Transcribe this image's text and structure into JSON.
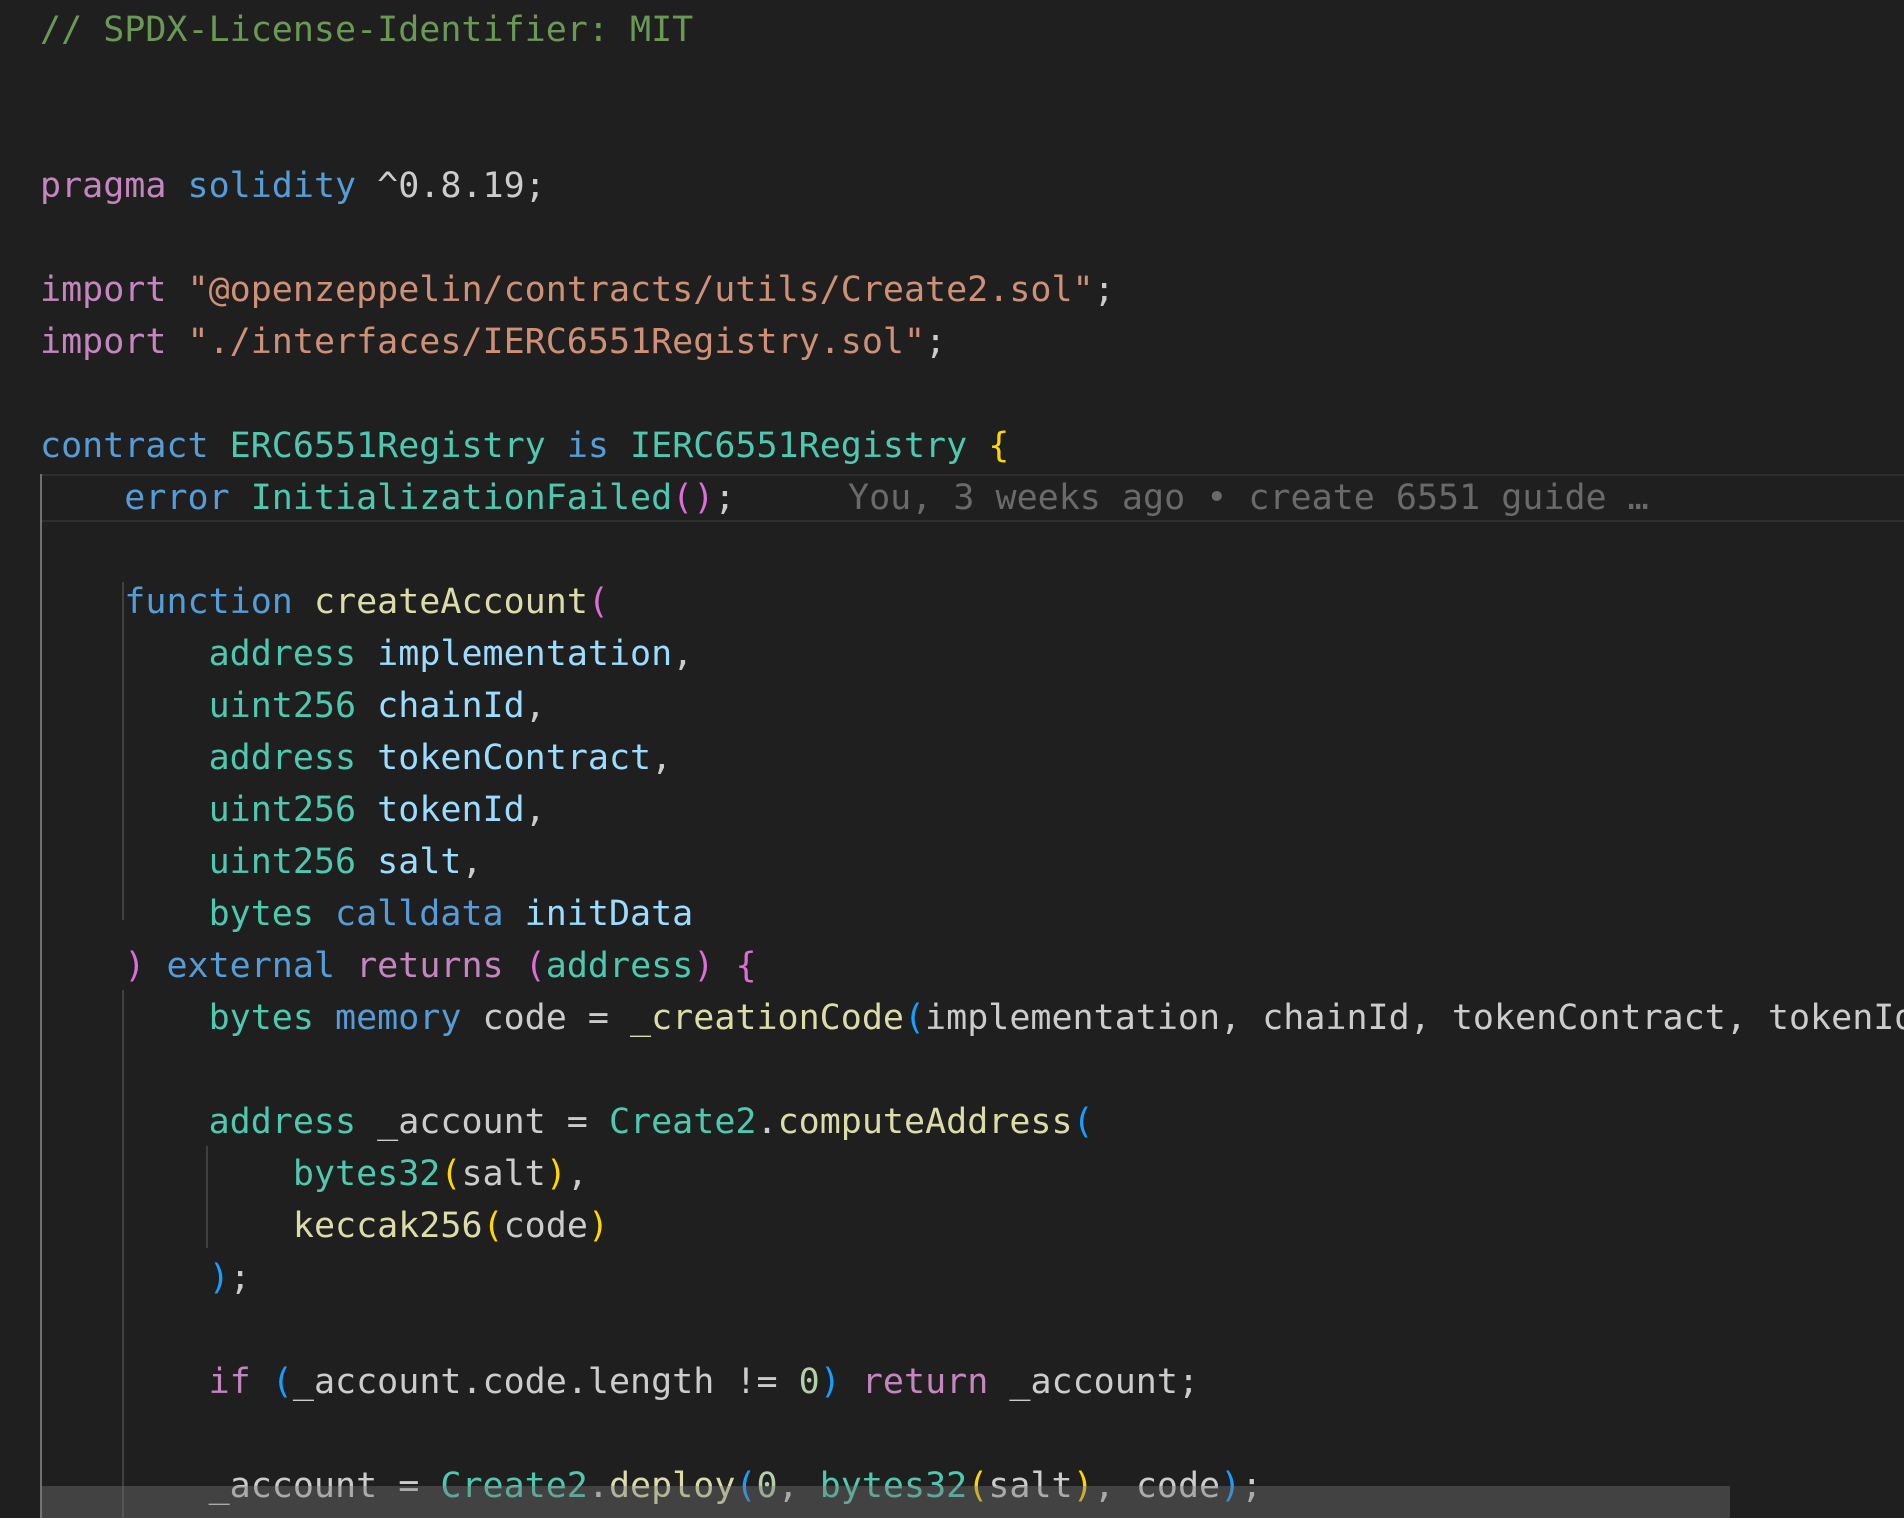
{
  "editor": {
    "theme_colors": {
      "background": "#1f1f1f",
      "comment": "#6a9955",
      "keyword_control": "#c586c0",
      "keyword": "#569cd6",
      "type": "#4ec9b0",
      "string": "#ce9178",
      "function": "#dcdcaa",
      "variable": "#9cdcfe",
      "number": "#b5cea8",
      "default": "#cccccc",
      "bracket_level1": "#ffd700",
      "bracket_level2": "#da70d6",
      "bracket_level3": "#179fff",
      "blame_text": "#6a6a6a"
    },
    "blame_annotation": "You, 3 weeks ago • create 6551 guide …",
    "lines": [
      {
        "t": [
          {
            "s": "// SPDX-License-Identifier: MIT",
            "c": "#6a9955"
          }
        ]
      },
      {
        "t": []
      },
      {
        "t": []
      },
      {
        "t": [
          {
            "s": "pragma",
            "c": "#c586c0"
          },
          {
            "s": " "
          },
          {
            "s": "solidity",
            "c": "#569cd6"
          },
          {
            "s": " ^0.8.19;",
            "c": "#cccccc"
          }
        ]
      },
      {
        "t": []
      },
      {
        "t": [
          {
            "s": "import",
            "c": "#c586c0"
          },
          {
            "s": " "
          },
          {
            "s": "\"@openzeppelin/contracts/utils/Create2.sol\"",
            "c": "#ce9178"
          },
          {
            "s": ";",
            "c": "#cccccc"
          }
        ]
      },
      {
        "t": [
          {
            "s": "import",
            "c": "#c586c0"
          },
          {
            "s": " "
          },
          {
            "s": "\"./interfaces/IERC6551Registry.sol\"",
            "c": "#ce9178"
          },
          {
            "s": ";",
            "c": "#cccccc"
          }
        ]
      },
      {
        "t": []
      },
      {
        "t": [
          {
            "s": "contract",
            "c": "#569cd6"
          },
          {
            "s": " "
          },
          {
            "s": "ERC6551Registry",
            "c": "#4ec9b0"
          },
          {
            "s": " "
          },
          {
            "s": "is",
            "c": "#569cd6"
          },
          {
            "s": " "
          },
          {
            "s": "IERC6551Registry",
            "c": "#4ec9b0"
          },
          {
            "s": " "
          },
          {
            "s": "{",
            "c": "#ffd700"
          }
        ]
      },
      {
        "t": [
          {
            "s": "    "
          },
          {
            "s": "error",
            "c": "#569cd6"
          },
          {
            "s": " "
          },
          {
            "s": "InitializationFailed",
            "c": "#4ec9b0"
          },
          {
            "s": "()",
            "c": "#da70d6"
          },
          {
            "s": ";",
            "c": "#cccccc"
          }
        ]
      },
      {
        "t": []
      },
      {
        "t": [
          {
            "s": "    "
          },
          {
            "s": "function",
            "c": "#569cd6"
          },
          {
            "s": " "
          },
          {
            "s": "createAccount",
            "c": "#dcdcaa"
          },
          {
            "s": "(",
            "c": "#da70d6"
          }
        ]
      },
      {
        "t": [
          {
            "s": "        "
          },
          {
            "s": "address",
            "c": "#4ec9b0"
          },
          {
            "s": " "
          },
          {
            "s": "implementation",
            "c": "#9cdcfe"
          },
          {
            "s": ",",
            "c": "#cccccc"
          }
        ]
      },
      {
        "t": [
          {
            "s": "        "
          },
          {
            "s": "uint256",
            "c": "#4ec9b0"
          },
          {
            "s": " "
          },
          {
            "s": "chainId",
            "c": "#9cdcfe"
          },
          {
            "s": ",",
            "c": "#cccccc"
          }
        ]
      },
      {
        "t": [
          {
            "s": "        "
          },
          {
            "s": "address",
            "c": "#4ec9b0"
          },
          {
            "s": " "
          },
          {
            "s": "tokenContract",
            "c": "#9cdcfe"
          },
          {
            "s": ",",
            "c": "#cccccc"
          }
        ]
      },
      {
        "t": [
          {
            "s": "        "
          },
          {
            "s": "uint256",
            "c": "#4ec9b0"
          },
          {
            "s": " "
          },
          {
            "s": "tokenId",
            "c": "#9cdcfe"
          },
          {
            "s": ",",
            "c": "#cccccc"
          }
        ]
      },
      {
        "t": [
          {
            "s": "        "
          },
          {
            "s": "uint256",
            "c": "#4ec9b0"
          },
          {
            "s": " "
          },
          {
            "s": "salt",
            "c": "#9cdcfe"
          },
          {
            "s": ",",
            "c": "#cccccc"
          }
        ]
      },
      {
        "t": [
          {
            "s": "        "
          },
          {
            "s": "bytes",
            "c": "#4ec9b0"
          },
          {
            "s": " "
          },
          {
            "s": "calldata",
            "c": "#569cd6"
          },
          {
            "s": " "
          },
          {
            "s": "initData",
            "c": "#9cdcfe"
          }
        ]
      },
      {
        "t": [
          {
            "s": "    "
          },
          {
            "s": ")",
            "c": "#da70d6"
          },
          {
            "s": " "
          },
          {
            "s": "external",
            "c": "#569cd6"
          },
          {
            "s": " "
          },
          {
            "s": "returns",
            "c": "#c586c0"
          },
          {
            "s": " "
          },
          {
            "s": "(",
            "c": "#da70d6"
          },
          {
            "s": "address",
            "c": "#4ec9b0"
          },
          {
            "s": ")",
            "c": "#da70d6"
          },
          {
            "s": " "
          },
          {
            "s": "{",
            "c": "#da70d6"
          }
        ]
      },
      {
        "t": [
          {
            "s": "        "
          },
          {
            "s": "bytes",
            "c": "#4ec9b0"
          },
          {
            "s": " "
          },
          {
            "s": "memory",
            "c": "#569cd6"
          },
          {
            "s": " code = ",
            "c": "#cccccc"
          },
          {
            "s": "_creationCode",
            "c": "#dcdcaa"
          },
          {
            "s": "(",
            "c": "#179fff"
          },
          {
            "s": "implementation, chainId, tokenContract, tokenId, salt",
            "c": "#cccccc"
          },
          {
            "s": ")",
            "c": "#179fff"
          },
          {
            "s": ";",
            "c": "#cccccc"
          }
        ]
      },
      {
        "t": []
      },
      {
        "t": [
          {
            "s": "        "
          },
          {
            "s": "address",
            "c": "#4ec9b0"
          },
          {
            "s": " _account = ",
            "c": "#cccccc"
          },
          {
            "s": "Create2",
            "c": "#4ec9b0"
          },
          {
            "s": ".",
            "c": "#cccccc"
          },
          {
            "s": "computeAddress",
            "c": "#dcdcaa"
          },
          {
            "s": "(",
            "c": "#179fff"
          }
        ]
      },
      {
        "t": [
          {
            "s": "            "
          },
          {
            "s": "bytes32",
            "c": "#4ec9b0"
          },
          {
            "s": "(",
            "c": "#ffd700"
          },
          {
            "s": "salt",
            "c": "#cccccc"
          },
          {
            "s": ")",
            "c": "#ffd700"
          },
          {
            "s": ",",
            "c": "#cccccc"
          }
        ]
      },
      {
        "t": [
          {
            "s": "            "
          },
          {
            "s": "keccak256",
            "c": "#dcdcaa"
          },
          {
            "s": "(",
            "c": "#ffd700"
          },
          {
            "s": "code",
            "c": "#cccccc"
          },
          {
            "s": ")",
            "c": "#ffd700"
          }
        ]
      },
      {
        "t": [
          {
            "s": "        "
          },
          {
            "s": ")",
            "c": "#179fff"
          },
          {
            "s": ";",
            "c": "#cccccc"
          }
        ]
      },
      {
        "t": []
      },
      {
        "t": [
          {
            "s": "        "
          },
          {
            "s": "if",
            "c": "#c586c0"
          },
          {
            "s": " "
          },
          {
            "s": "(",
            "c": "#179fff"
          },
          {
            "s": "_account.code.length != ",
            "c": "#cccccc"
          },
          {
            "s": "0",
            "c": "#b5cea8"
          },
          {
            "s": ")",
            "c": "#179fff"
          },
          {
            "s": " "
          },
          {
            "s": "return",
            "c": "#c586c0"
          },
          {
            "s": " _account;",
            "c": "#cccccc"
          }
        ]
      },
      {
        "t": []
      },
      {
        "t": [
          {
            "s": "        "
          },
          {
            "s": "_account = ",
            "c": "#cccccc"
          },
          {
            "s": "Create2",
            "c": "#4ec9b0"
          },
          {
            "s": ".",
            "c": "#cccccc"
          },
          {
            "s": "deploy",
            "c": "#dcdcaa"
          },
          {
            "s": "(",
            "c": "#179fff"
          },
          {
            "s": "0",
            "c": "#b5cea8"
          },
          {
            "s": ", ",
            "c": "#cccccc"
          },
          {
            "s": "bytes32",
            "c": "#4ec9b0"
          },
          {
            "s": "(",
            "c": "#ffd700"
          },
          {
            "s": "salt",
            "c": "#cccccc"
          },
          {
            "s": ")",
            "c": "#ffd700"
          },
          {
            "s": ", code",
            "c": "#cccccc"
          },
          {
            "s": ")",
            "c": "#179fff"
          },
          {
            "s": ";",
            "c": "#cccccc"
          }
        ]
      }
    ]
  }
}
